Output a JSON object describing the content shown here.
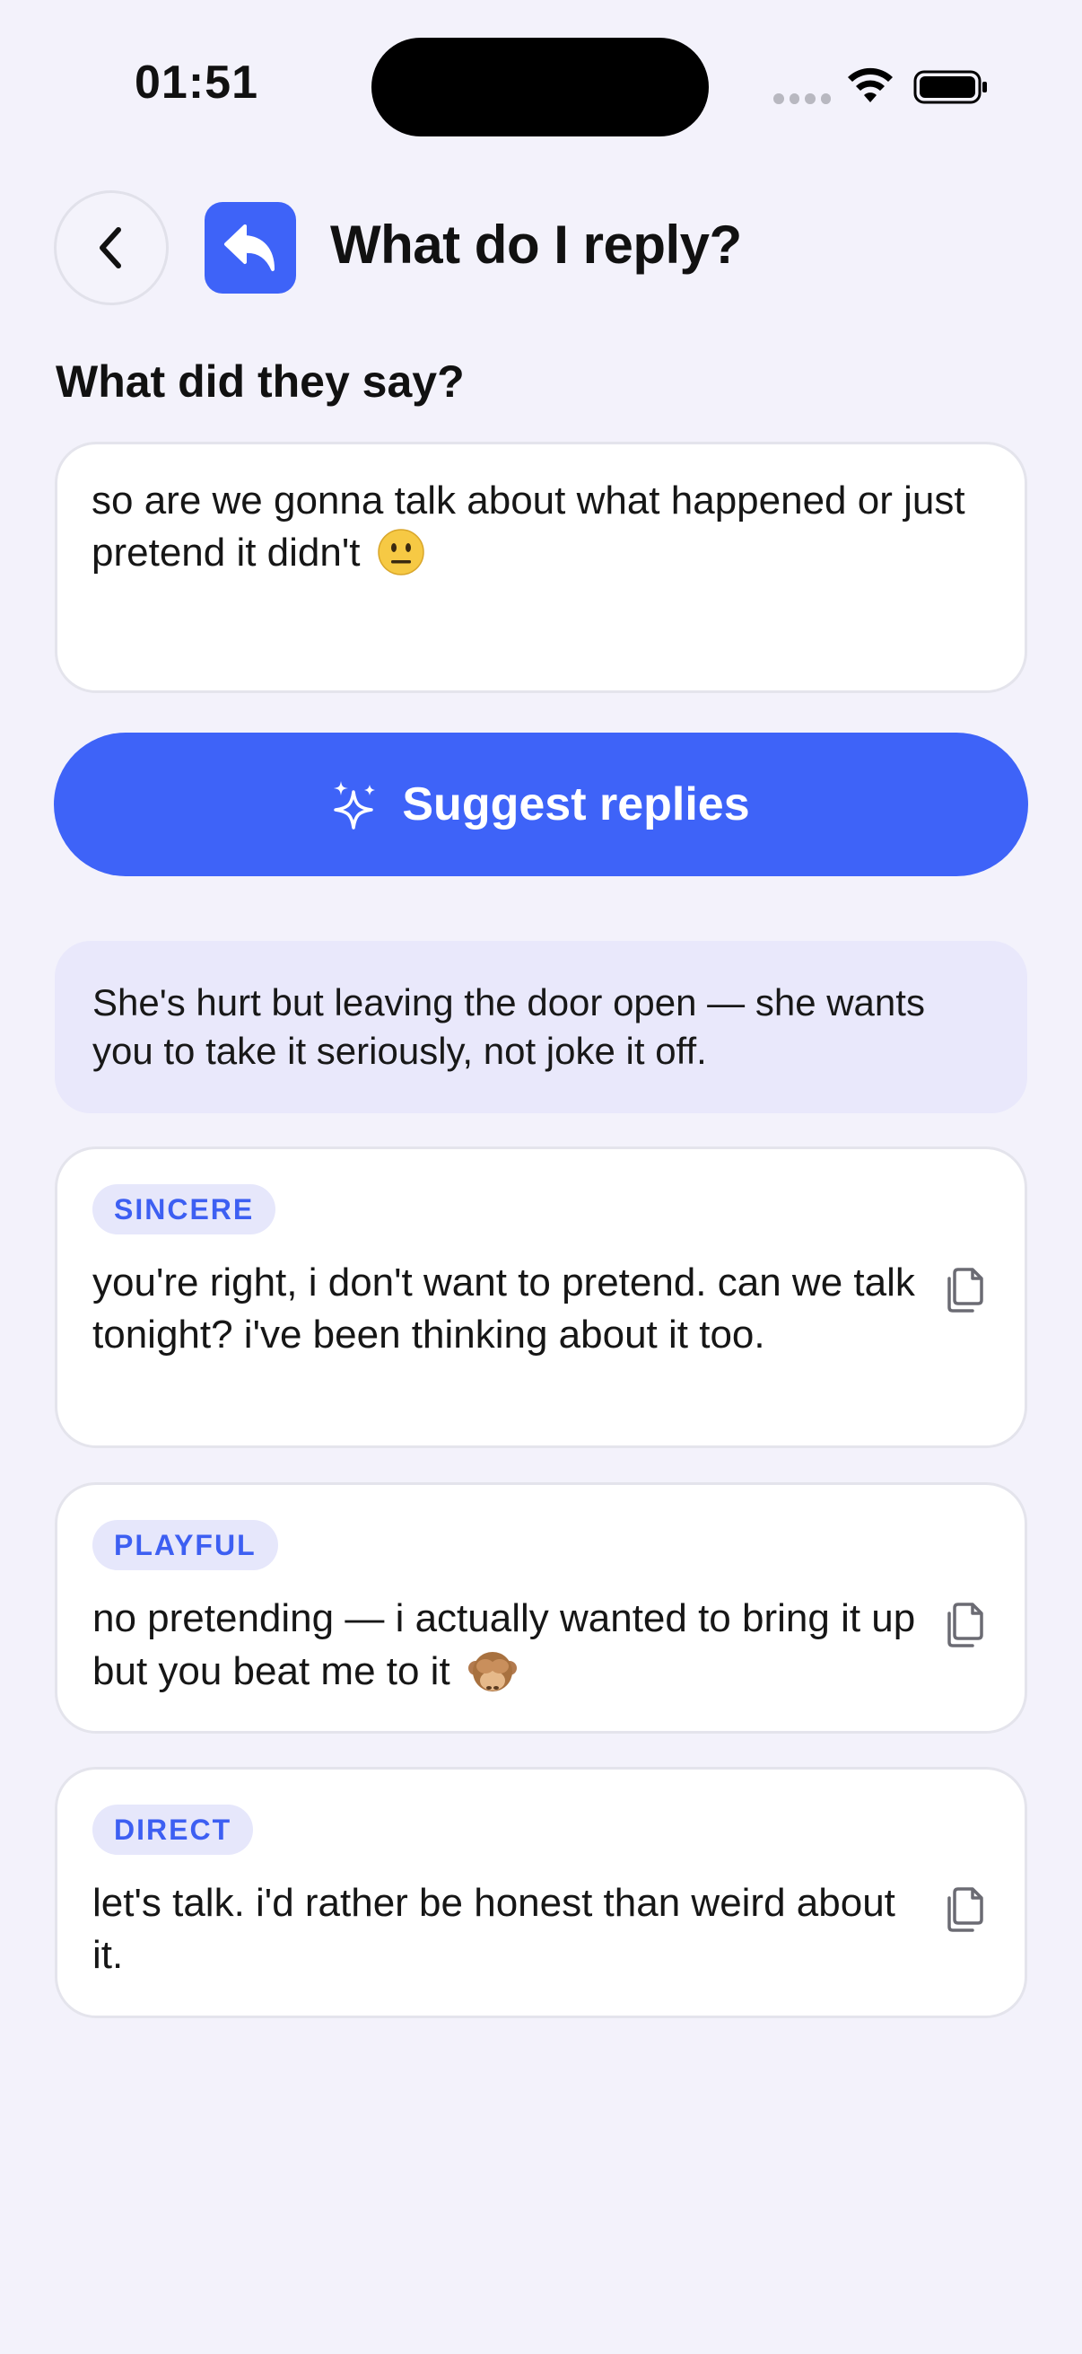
{
  "status_bar": {
    "time": "01:51"
  },
  "header": {
    "title": "What do I reply?",
    "back_icon": "chevron-left-icon",
    "app_icon": "reply-arrow-icon"
  },
  "input_section": {
    "label": "What did they say?",
    "message": "so are we gonna talk about what happened or just pretend it didn't",
    "message_emoji": "neutral-face-emoji"
  },
  "suggest_button": {
    "label": "Suggest replies",
    "icon": "sparkles-icon"
  },
  "insight": {
    "text": "She's hurt but leaving the door open — she wants you to take it seriously, not joke it off."
  },
  "replies": [
    {
      "tone": "SINCERE",
      "text": "you're right, i don't want to pretend. can we talk tonight? i've been thinking about it too."
    },
    {
      "tone": "PLAYFUL",
      "text": "no pretending — i actually wanted to bring it up but you beat me to it",
      "emoji": "see-no-evil-monkey-emoji"
    },
    {
      "tone": "DIRECT",
      "text": "let's talk. i'd rather be honest than weird about it."
    }
  ],
  "colors": {
    "background": "#f3f2fb",
    "accent": "#3e63f8",
    "insight_bg": "#e9e8fb",
    "badge_bg": "#e6e7fb",
    "badge_text": "#3d5ff2"
  }
}
